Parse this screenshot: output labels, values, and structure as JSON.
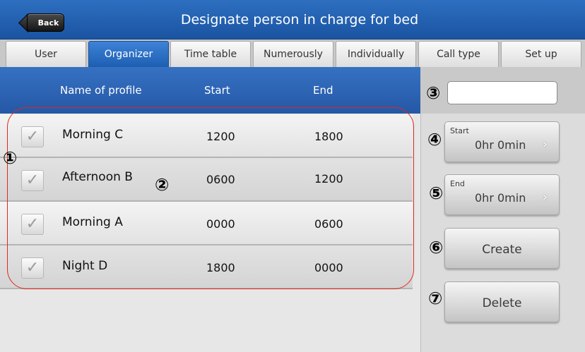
{
  "header": {
    "back_label": "Back",
    "title": "Designate person in charge for bed"
  },
  "tabs": [
    {
      "label": "User",
      "active": false
    },
    {
      "label": "Organizer",
      "active": true
    },
    {
      "label": "Time table",
      "active": false
    },
    {
      "label": "Numerously",
      "active": false
    },
    {
      "label": "Individually",
      "active": false
    },
    {
      "label": "Call type",
      "active": false
    },
    {
      "label": "Set up",
      "active": false
    }
  ],
  "list": {
    "columns": {
      "name": "Name of profile",
      "start": "Start",
      "end": "End"
    },
    "rows": [
      {
        "name": "Morning C",
        "start": "1200",
        "end": "1800",
        "checked": true
      },
      {
        "name": "Afternoon B",
        "start": "0600",
        "end": "1200",
        "checked": true
      },
      {
        "name": "Morning A",
        "start": "0000",
        "end": "0600",
        "checked": true
      },
      {
        "name": "Night D",
        "start": "1800",
        "end": "0000",
        "checked": true
      }
    ]
  },
  "panel": {
    "profile_name_value": "",
    "start": {
      "label": "Start",
      "value": "0hr 0min"
    },
    "end": {
      "label": "End",
      "value": "0hr 0min"
    },
    "create_label": "Create",
    "delete_label": "Delete"
  },
  "annotations": {
    "m1": "①",
    "m2": "②",
    "m3": "③",
    "m4": "④",
    "m5": "⑤",
    "m6": "⑥",
    "m7": "⑦"
  },
  "chevron": "›",
  "check_glyph": "✓",
  "colors": {
    "title_bar": "#1f5ba8",
    "active_tab": "#2a6cc4",
    "outline": "#e0281e"
  }
}
